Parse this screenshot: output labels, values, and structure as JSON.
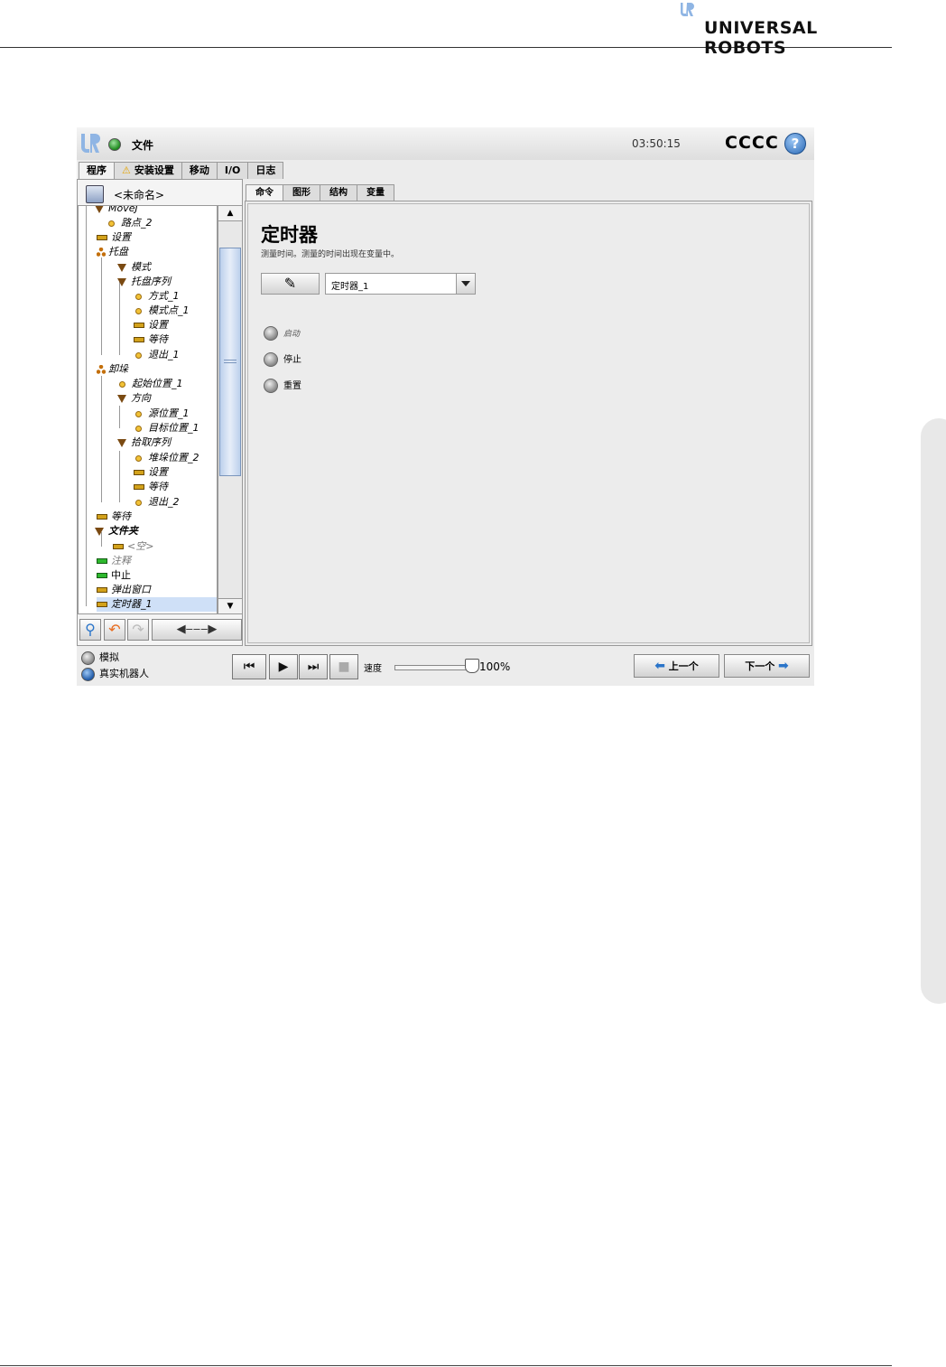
{
  "doc": {
    "brand": "UNIVERSAL ROBOTS"
  },
  "topbar": {
    "file_menu": "文件",
    "clock": "03:50:15",
    "robot_name": "CCCC",
    "help": "?"
  },
  "main_tabs": [
    "程序",
    "安装设置",
    "移动",
    "I/O",
    "日志"
  ],
  "program": {
    "name": "<未命名>"
  },
  "tree": [
    {
      "label": "MoveJ"
    },
    {
      "label": "路点_2"
    },
    {
      "label": "设置"
    },
    {
      "label": "托盘"
    },
    {
      "label": "模式"
    },
    {
      "label": "托盘序列"
    },
    {
      "label": "方式_1"
    },
    {
      "label": "模式点_1"
    },
    {
      "label": "设置"
    },
    {
      "label": "等待"
    },
    {
      "label": "退出_1"
    },
    {
      "label": "卸垛"
    },
    {
      "label": "起始位置_1"
    },
    {
      "label": "方向"
    },
    {
      "label": "源位置_1"
    },
    {
      "label": "目标位置_1"
    },
    {
      "label": "拾取序列"
    },
    {
      "label": "堆垛位置_2"
    },
    {
      "label": "设置"
    },
    {
      "label": "等待"
    },
    {
      "label": "退出_2"
    },
    {
      "label": "等待"
    },
    {
      "label": "文件夹"
    },
    {
      "label": "<空>"
    },
    {
      "label": "注释"
    },
    {
      "label": "中止"
    },
    {
      "label": "弹出窗口"
    },
    {
      "label": "定时器_1"
    }
  ],
  "sub_tabs": [
    "命令",
    "图形",
    "结构",
    "变量"
  ],
  "node": {
    "title": "定时器",
    "description": "测量时间。测量的时间出现在变量中。",
    "edit_icon": "pencil-icon",
    "timer_name": "定时器_1",
    "options": [
      "启动",
      "停止",
      "重置"
    ]
  },
  "bottom": {
    "modes": [
      "模拟",
      "真实机器人"
    ],
    "speed_label": "速度",
    "speed_value": "100%",
    "speed_fraction": 1.0,
    "prev_label": "上一个",
    "next_label": "下一个"
  },
  "colors": {
    "accent": "#2a74c9",
    "status_ok": "#1d8a1d",
    "warning": "#e5a300"
  }
}
